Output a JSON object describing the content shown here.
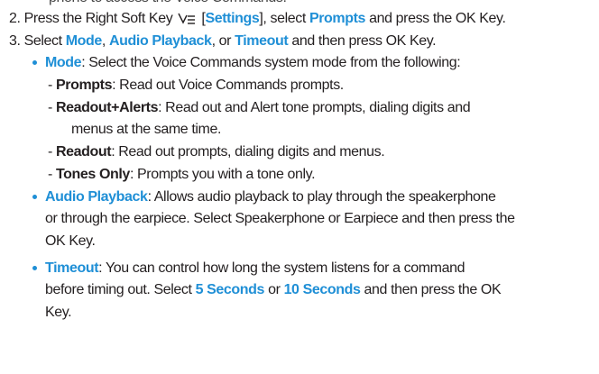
{
  "step1_tail": "phone to access the Voice Commands.",
  "step2": {
    "a": "2. Press the Right Soft Key ",
    "icon": "right-soft-key-icon",
    "b": " [",
    "settings": "Settings",
    "c": "], select ",
    "prompts": "Prompts",
    "d": " and press the OK Key."
  },
  "step3": {
    "a": "3. Select ",
    "mode": "Mode",
    "sep1": ", ",
    "audio": "Audio Playback",
    "sep2": ", or ",
    "timeout": "Timeout",
    "d": " and then press OK Key."
  },
  "mode": {
    "term": "Mode",
    "desc": ": Select the Voice Commands system mode from the following:",
    "options": [
      {
        "dash": "- ",
        "term": "Prompts",
        "desc": ": Read out Voice Commands prompts."
      },
      {
        "dash": "-  ",
        "term": "Readout+Alerts",
        "desc": ": Read out and Alert tone prompts, dialing digits and",
        "cont": "menus at the same time."
      },
      {
        "dash": "-  ",
        "term": "Readout",
        "desc": ": Read out prompts, dialing digits and menus."
      },
      {
        "dash": "-  ",
        "term": "Tones Only",
        "desc": ": Prompts you with a tone only."
      }
    ]
  },
  "audio": {
    "term": "Audio Playback",
    "desc": ": Allows audio playback to play through the speakerphone",
    "line2": "or through the earpiece. Select Speakerphone or Earpiece and then press the",
    "line3": "OK Key."
  },
  "timeout": {
    "term": "Timeout",
    "desc": ": You can control how long the system listens for a command",
    "line2a": "before timing out. Select ",
    "five": "5 Seconds",
    "or": " or ",
    "ten": "10 Seconds",
    "line2b": " and then press the OK",
    "line3": "Key."
  },
  "colors": {
    "accent": "#1f8fd6",
    "text": "#231f20"
  }
}
